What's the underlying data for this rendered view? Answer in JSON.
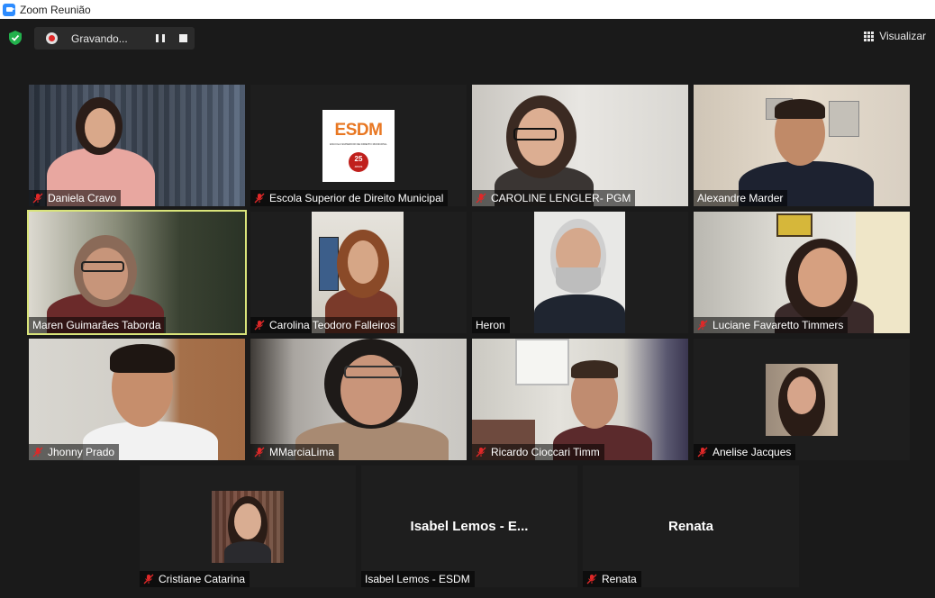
{
  "window": {
    "title": "Zoom Reunião"
  },
  "toolbar": {
    "recording_label": "Gravando...",
    "view_label": "Visualizar"
  },
  "participants": [
    {
      "name": "Daniela Cravo",
      "muted": true
    },
    {
      "name": "Escola Superior de Direito Municipal",
      "muted": true
    },
    {
      "name": "CAROLINE LENGLER- PGM",
      "muted": true
    },
    {
      "name": "Alexandre Marder",
      "muted": false
    },
    {
      "name": "Maren Guimarães Taborda",
      "muted": false,
      "active_speaker": true
    },
    {
      "name": "Carolina Teodoro Falleiros",
      "muted": true
    },
    {
      "name": "Heron",
      "muted": false
    },
    {
      "name": "Luciane Favaretto Timmers",
      "muted": true
    },
    {
      "name": "Jhonny Prado",
      "muted": true
    },
    {
      "name": "MMarciaLima",
      "muted": true
    },
    {
      "name": "Ricardo Cioccari Timm",
      "muted": true
    },
    {
      "name": "Anelise Jacques",
      "muted": true
    },
    {
      "name": "Cristiane Catarina",
      "muted": true
    },
    {
      "name": "Isabel Lemos - ESDM",
      "muted": false,
      "video_off_label": "Isabel Lemos - E..."
    },
    {
      "name": "Renata",
      "muted": true,
      "video_off_label": "Renata"
    }
  ],
  "esdm_logo": {
    "acronym": "ESDM",
    "subtitle": "ESCOLA SUPERIOR DE DIREITO MUNICIPAL",
    "anniversary": "25",
    "anniversary_unit": "anos"
  },
  "colors": {
    "background": "#1a1a1a",
    "active_speaker_border": "#d9e47a",
    "muted_icon": "#e02828",
    "shield": "#22b14c",
    "zoom_blue": "#2d8cff"
  }
}
